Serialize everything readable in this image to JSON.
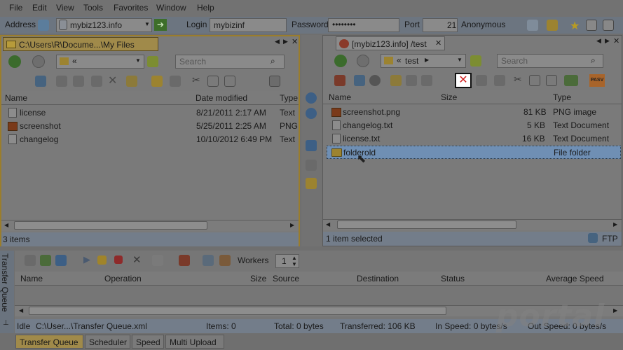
{
  "menu": {
    "items": [
      "File",
      "Edit",
      "View",
      "Tools",
      "Favorites",
      "Window",
      "Help"
    ]
  },
  "address_bar": {
    "address_label": "Address",
    "host": "mybiz123.info",
    "login_label": "Login",
    "login_value": "mybizinf",
    "password_label": "Password",
    "password_value": "••••••••",
    "port_label": "Port",
    "port_value": "21",
    "anonymous_label": "Anonymous"
  },
  "local_panel": {
    "tab_title": "C:\\Users\\R\\Docume...\\My Files",
    "path": "«",
    "search_placeholder": "Search",
    "columns": [
      "Name",
      "Date modified",
      "Type"
    ],
    "files": [
      {
        "name": "license",
        "date": "8/21/2011 2:17 AM",
        "type": "Text"
      },
      {
        "name": "screenshot",
        "date": "5/25/2011 2:25 AM",
        "type": "PNG"
      },
      {
        "name": "changelog",
        "date": "10/10/2012 6:49 PM",
        "type": "Text"
      }
    ],
    "status": "3 items"
  },
  "remote_panel": {
    "tab_title": "[mybiz123.info] /test",
    "path_prefix": "«",
    "path": "test",
    "search_placeholder": "Search",
    "pasv_label": "PASV",
    "columns": [
      "Name",
      "Size",
      "Type"
    ],
    "files": [
      {
        "name": "screenshot.png",
        "size": "81 KB",
        "type": "PNG image"
      },
      {
        "name": "changelog.txt",
        "size": "5 KB",
        "type": "Text Document"
      },
      {
        "name": "license.txt",
        "size": "16 KB",
        "type": "Text Document"
      },
      {
        "name": "folderold",
        "size": "",
        "type": "File folder"
      }
    ],
    "status": "1 item selected",
    "protocol": "FTP"
  },
  "queue": {
    "side_label": "Transfer Queue",
    "workers_label": "Workers",
    "workers_value": "1",
    "columns": [
      "Name",
      "Operation",
      "Size",
      "Source",
      "Destination",
      "Status",
      "Average Speed"
    ],
    "status": {
      "idle": "Idle",
      "file": "C:\\User...\\Transfer Queue.xml",
      "items": "Items: 0",
      "total": "Total: 0 bytes",
      "transferred": "Transferred: 106 KB",
      "in_speed": "In Speed: 0 bytes/s",
      "out_speed": "Out Speed: 0 bytes/s"
    }
  },
  "bottom_tabs": [
    "Transfer Queue",
    "Scheduler",
    "Speed",
    "Multi Upload"
  ],
  "watermark": "portal",
  "colors": {
    "accent_yellow": "#c8a54a",
    "selection_blue": "#6f8fb4",
    "highlight_red": "#d02020"
  }
}
